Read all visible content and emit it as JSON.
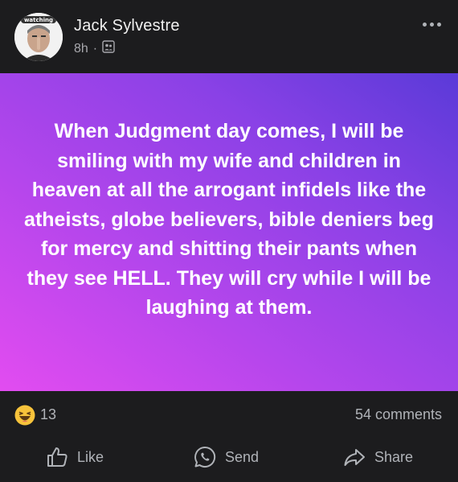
{
  "post": {
    "author": "Jack Sylvestre",
    "avatar_badge": "watching",
    "time": "8h",
    "separator": "·",
    "audience_icon": "friends-icon",
    "more_icon": "more-options-icon",
    "text": "When Judgment day comes, I will be smiling with my wife and children in heaven at all the arrogant infidels like the atheists, globe believers, bible deniers beg for mercy and shitting their pants when they see HELL.  They will cry while I will be laughing at them.",
    "background_colors": [
      "#e24cf0",
      "#8a41e6",
      "#5a3ad8"
    ]
  },
  "reactions": {
    "emoji_icon": "haha-reaction-icon",
    "count": "13",
    "comments": "54 comments"
  },
  "actions": {
    "like_label": "Like",
    "send_label": "Send",
    "share_label": "Share"
  }
}
